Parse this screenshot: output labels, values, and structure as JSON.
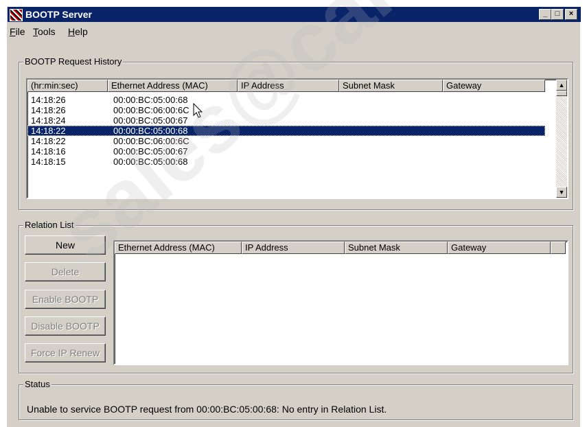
{
  "window": {
    "title": "BOOTP Server"
  },
  "menu": [
    {
      "label": "File",
      "u": "F",
      "rest": "ile"
    },
    {
      "label": "Tools",
      "u": "T",
      "rest": "ools"
    },
    {
      "label": "Help",
      "u": "H",
      "rest": "elp"
    }
  ],
  "history": {
    "group_label": "BOOTP Request History",
    "columns": [
      "(hr:min:sec)",
      "Ethernet Address (MAC)",
      "IP Address",
      "Subnet Mask",
      "Gateway"
    ],
    "rows": [
      {
        "time": "14:18:26",
        "mac": "00:00:BC:05:00:68"
      },
      {
        "time": "14:18:26",
        "mac": "00:00:BC:06:00:6C"
      },
      {
        "time": "14:18:24",
        "mac": "00:00:BC:05:00:67"
      },
      {
        "time": "14:18:22",
        "mac": "00:00:BC:05:00:68",
        "selected": true
      },
      {
        "time": "14:18:22",
        "mac": "00:00:BC:06:00:6C"
      },
      {
        "time": "14:18:16",
        "mac": "00:00:BC:05:00:67"
      },
      {
        "time": "14:18:15",
        "mac": "00:00:BC:05:00:68"
      }
    ]
  },
  "relation": {
    "group_label": "Relation List",
    "columns": [
      "Ethernet Address (MAC)",
      "IP Address",
      "Subnet Mask",
      "Gateway"
    ],
    "buttons": {
      "new": "New",
      "delete": "Delete",
      "enable": "Enable BOOTP",
      "disable": "Disable BOOTP",
      "force": "Force IP Renew"
    }
  },
  "status": {
    "group_label": "Status",
    "message": "Unable to service BOOTP request from 00:00:BC:05:00:68:  No entry in Relation List."
  },
  "colors": {
    "titlebar": "#0a246a",
    "face": "#d4d0c8",
    "selection": "#0a246a"
  },
  "watermark": "sales@cambia..."
}
